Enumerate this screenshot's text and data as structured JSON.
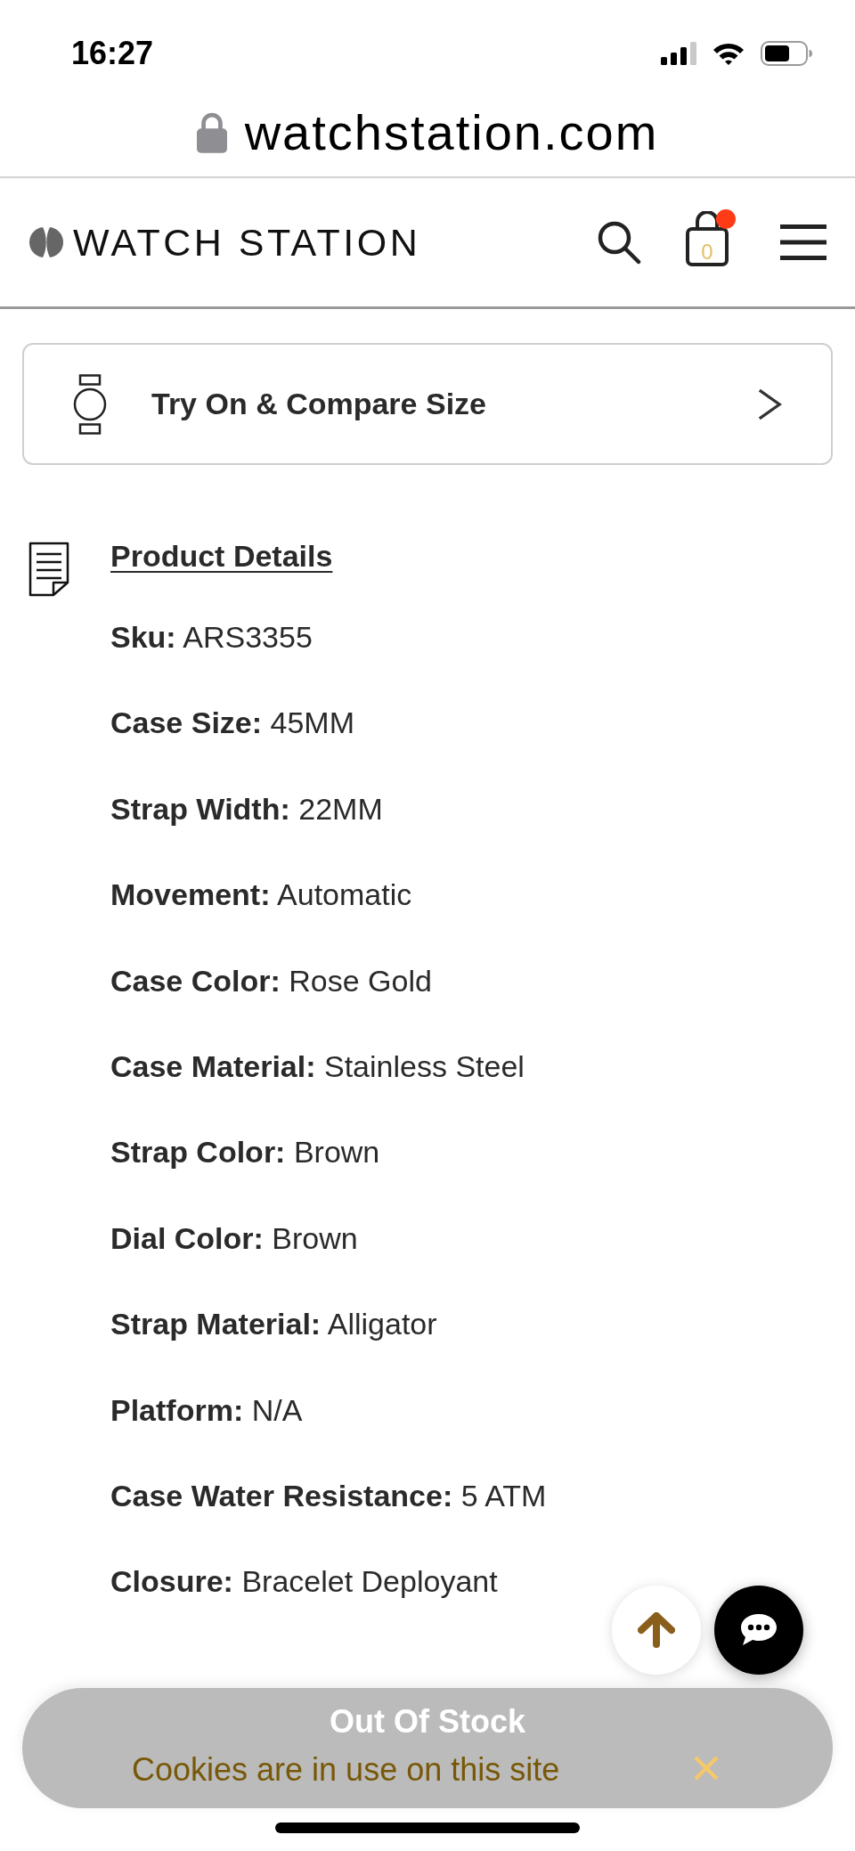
{
  "status_bar": {
    "time": "16:27"
  },
  "address_bar": {
    "url": "watchstation.com"
  },
  "header": {
    "brand": "WATCH STATION",
    "cart_count": "0",
    "cart_alert": true
  },
  "try_on_button": {
    "label": "Try On & Compare Size"
  },
  "product_details": {
    "title": "Product Details",
    "specs": [
      {
        "label": "Sku:",
        "value": "ARS3355"
      },
      {
        "label": "Case Size:",
        "value": "45MM"
      },
      {
        "label": "Strap Width:",
        "value": "22MM"
      },
      {
        "label": "Movement:",
        "value": "Automatic"
      },
      {
        "label": "Case Color:",
        "value": "Rose Gold"
      },
      {
        "label": "Case Material:",
        "value": "Stainless Steel"
      },
      {
        "label": "Strap Color:",
        "value": "Brown"
      },
      {
        "label": "Dial Color:",
        "value": "Brown"
      },
      {
        "label": "Strap Material:",
        "value": "Alligator"
      },
      {
        "label": "Platform:",
        "value": "N/A"
      },
      {
        "label": "Case Water Resistance:",
        "value": "5 ATM"
      },
      {
        "label": "Closure:",
        "value": "Bracelet Deployant"
      }
    ]
  },
  "stock_button": {
    "label": "Out Of Stock",
    "disabled": true
  },
  "cookie_notice": {
    "text": "Cookies are in use on this site"
  }
}
